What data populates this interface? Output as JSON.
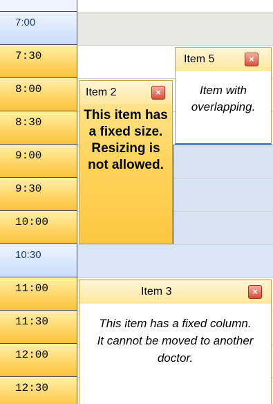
{
  "time_slots": [
    {
      "label": "7:00",
      "type": "off"
    },
    {
      "label": "7:30",
      "type": "work"
    },
    {
      "label": "8:00",
      "type": "work"
    },
    {
      "label": "8:30",
      "type": "work"
    },
    {
      "label": "9:00",
      "type": "work"
    },
    {
      "label": "9:30",
      "type": "work"
    },
    {
      "label": "10:00",
      "type": "work"
    },
    {
      "label": "10:30",
      "type": "off"
    },
    {
      "label": "11:00",
      "type": "work"
    },
    {
      "label": "11:30",
      "type": "work"
    },
    {
      "label": "12:00",
      "type": "work"
    },
    {
      "label": "12:30",
      "type": "work"
    }
  ],
  "items": {
    "item2": {
      "title": "Item 2",
      "body": "This item has a fixed size. Resizing is not allowed."
    },
    "item3": {
      "title": "Item 3",
      "body": "This item has a fixed column. It cannot be moved to another doctor."
    },
    "item5": {
      "title": "Item 5",
      "body": "Item with overlapping."
    }
  },
  "close_glyph": "×",
  "colors": {
    "work_slot": "#ffcf58",
    "off_slot": "#c8dcfa",
    "item_header": "#ffe7a0",
    "item2_fill": "#ffd45c",
    "close_button": "#d44e3a"
  }
}
